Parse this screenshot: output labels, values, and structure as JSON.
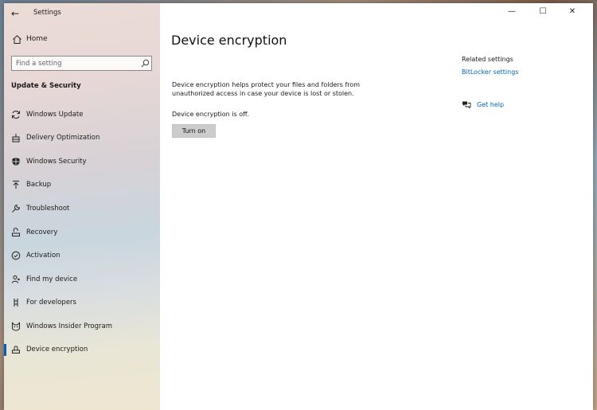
{
  "window": {
    "app_title": "Settings",
    "back_glyph": "←",
    "controls": {
      "minimize": "—",
      "maximize": "☐",
      "close": "✕"
    }
  },
  "sidebar": {
    "home_label": "Home",
    "search_placeholder": "Find a setting",
    "section_title": "Update & Security",
    "items": [
      {
        "label": "Windows Update",
        "icon": "refresh-icon"
      },
      {
        "label": "Delivery Optimization",
        "icon": "delivery-icon"
      },
      {
        "label": "Windows Security",
        "icon": "shield-icon"
      },
      {
        "label": "Backup",
        "icon": "backup-arrow-icon"
      },
      {
        "label": "Troubleshoot",
        "icon": "wrench-icon"
      },
      {
        "label": "Recovery",
        "icon": "recovery-icon"
      },
      {
        "label": "Activation",
        "icon": "check-circle-icon"
      },
      {
        "label": "Find my device",
        "icon": "person-pin-icon"
      },
      {
        "label": "For developers",
        "icon": "developer-icon"
      },
      {
        "label": "Windows Insider Program",
        "icon": "insider-cat-icon"
      },
      {
        "label": "Device encryption",
        "icon": "drive-icon",
        "selected": true
      }
    ]
  },
  "main": {
    "title": "Device encryption",
    "description": "Device encryption helps protect your files and folders from unauthorized access in case your device is lost or stolen.",
    "status": "Device encryption is off.",
    "turn_on_label": "Turn on"
  },
  "related": {
    "title": "Related settings",
    "bitlocker_link": "BitLocker settings",
    "get_help_link": "Get help"
  },
  "colors": {
    "accent": "#0063b1",
    "link": "#0067b8",
    "button_bg": "#cccccc"
  }
}
